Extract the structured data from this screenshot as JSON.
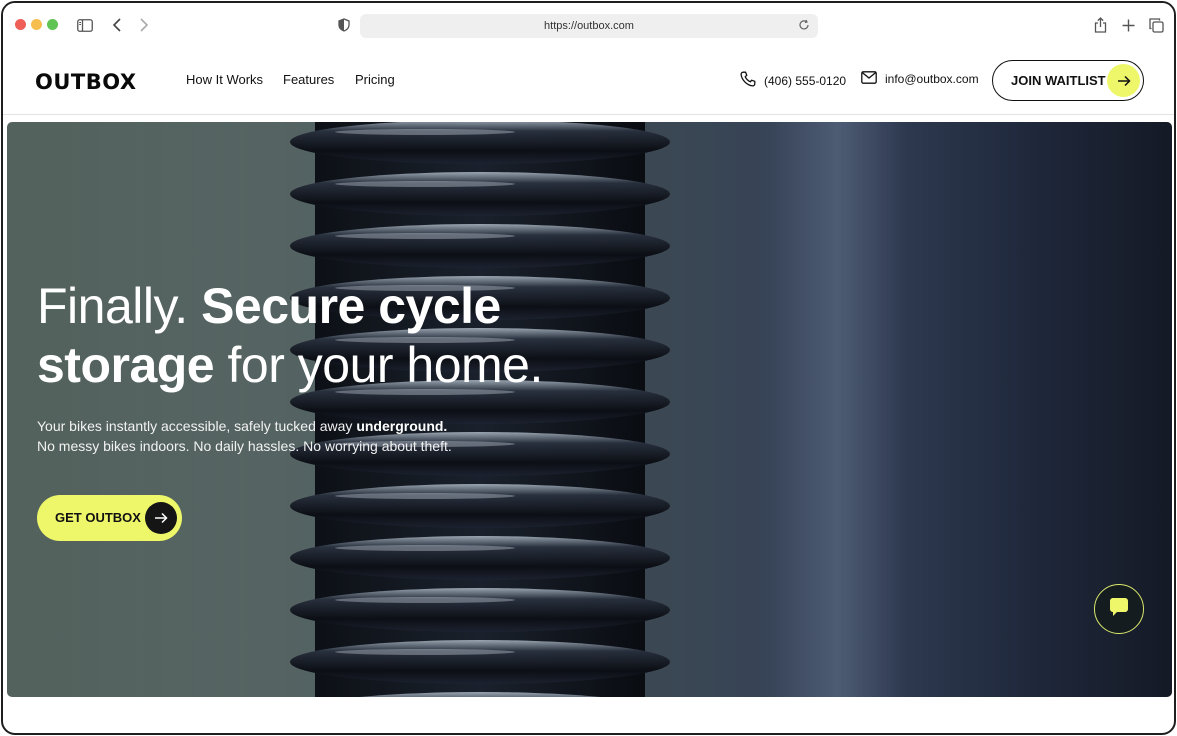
{
  "browser": {
    "url": "https://outbox.com"
  },
  "nav": {
    "logo": "OUTBOX",
    "links": [
      "How It Works",
      "Features",
      "Pricing"
    ],
    "phone": "(406) 555-0120",
    "email": "info@outbox.com",
    "waitlist_label": "JOIN WAITLIST"
  },
  "hero": {
    "title_part1": "Finally. ",
    "title_bold1": "Secure cycle storage",
    "title_part2": " for your home.",
    "sub_line1": "Your bikes instantly accessible, safely tucked away ",
    "sub_bold": "underground.",
    "sub_line2": "No messy bikes indoors. No daily hassles. No worrying about theft.",
    "cta_label": "GET OUTBOX"
  },
  "colors": {
    "accent": "#eef76a",
    "dark": "#151515"
  },
  "icons": {
    "phone": "phone-icon",
    "email": "mail-icon",
    "arrow": "arrow-right-icon",
    "chat": "chat-bubble-icon"
  }
}
